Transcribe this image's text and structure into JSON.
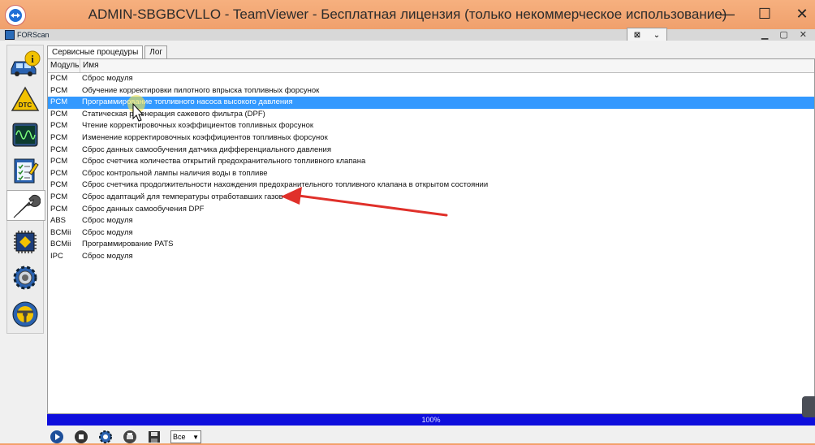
{
  "window": {
    "title": "ADMIN-SBGBCVLLO - TeamViewer - Бесплатная лицензия (только некоммерческое использование)",
    "minimize": "—",
    "maximize": "☐",
    "close": "✕"
  },
  "remote": {
    "app_label": "FORScan"
  },
  "tabs": [
    {
      "label": "Сервисные процедуры",
      "active": true
    },
    {
      "label": "Лог",
      "active": false
    }
  ],
  "table": {
    "columns": [
      "Модуль",
      "Имя"
    ],
    "rows": [
      {
        "module": "PCM",
        "name": "Сброс модуля"
      },
      {
        "module": "PCM",
        "name": "Обучение корректировки пилотного впрыска топливных форсунок"
      },
      {
        "module": "PCM",
        "name": "Программирование топливного насоса высокого давления"
      },
      {
        "module": "PCM",
        "name": "Статическая регенерация сажевого фильтра (DPF)"
      },
      {
        "module": "PCM",
        "name": "Чтение корректировочных коэффициентов топливных форсунок"
      },
      {
        "module": "PCM",
        "name": "Изменение корректировочных коэффициентов топливных форсунок"
      },
      {
        "module": "PCM",
        "name": "Сброс данных самообучения датчика дифференциального давления"
      },
      {
        "module": "PCM",
        "name": "Сброс счетчика количества открытий предохранительного топливного клапана"
      },
      {
        "module": "PCM",
        "name": "Сброс контрольной лампы наличия воды в топливе"
      },
      {
        "module": "PCM",
        "name": "Сброс счетчика продолжительности нахождения предохранительного топливного клапана в открытом состоянии"
      },
      {
        "module": "PCM",
        "name": "Сброс адаптаций для температуры отработавших газов"
      },
      {
        "module": "PCM",
        "name": "Сброс данных самообучения DPF"
      },
      {
        "module": "ABS",
        "name": "Сброс модуля"
      },
      {
        "module": "BCMii",
        "name": "Сброс модуля"
      },
      {
        "module": "BCMii",
        "name": "Программирование PATS"
      },
      {
        "module": "IPC",
        "name": "Сброс модуля"
      }
    ],
    "selected_index": 2
  },
  "progress": {
    "label": "100%",
    "value": 1.0
  },
  "filter": {
    "selected": "Все"
  },
  "colors": {
    "title_bar": "#f3a06a",
    "selection": "#3399ff",
    "progress": "#1010e8",
    "annotation_arrow": "#e0302a"
  },
  "icons": {
    "sidebar": [
      "vehicle-info-icon",
      "dtc-icon",
      "oscilloscope-icon",
      "checklist-icon",
      "wrench-icon",
      "chip-icon",
      "gear-icon",
      "steering-wheel-icon"
    ],
    "bottom": [
      "play-icon",
      "stop-icon",
      "settings-icon",
      "print-icon",
      "save-icon"
    ]
  }
}
